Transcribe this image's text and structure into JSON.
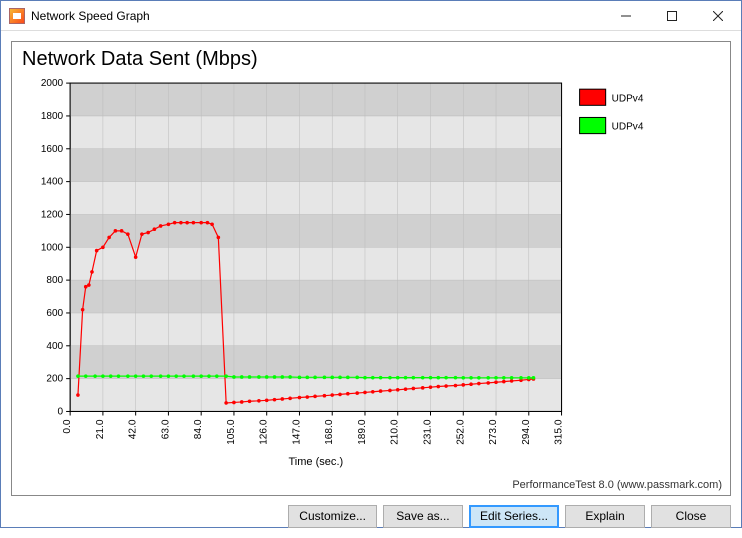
{
  "window": {
    "title": "Network Speed Graph"
  },
  "chart": {
    "title": "Network Data Sent (Mbps)",
    "xlabel": "Time (sec.)",
    "ylim": [
      0,
      2000
    ],
    "yticks": [
      0,
      200,
      400,
      600,
      800,
      1000,
      1200,
      1400,
      1600,
      1800,
      2000
    ],
    "xticks": [
      0.0,
      21.0,
      42.0,
      63.0,
      84.0,
      105.0,
      126.0,
      147.0,
      168.0,
      189.0,
      210.0,
      231.0,
      252.0,
      273.0,
      294.0,
      315.0
    ],
    "legend": [
      {
        "label": "UDPv4",
        "color": "#ff0000"
      },
      {
        "label": "UDPv4",
        "color": "#00ff00"
      }
    ],
    "footer": "PerformanceTest 8.0 (www.passmark.com)"
  },
  "buttons": {
    "customize": "Customize...",
    "saveas": "Save as...",
    "editseries": "Edit Series...",
    "explain": "Explain",
    "close": "Close"
  },
  "chart_data": {
    "type": "line",
    "title": "Network Data Sent (Mbps)",
    "xlabel": "Time (sec.)",
    "ylabel": "",
    "xlim": [
      0,
      315
    ],
    "ylim": [
      0,
      2000
    ],
    "series": [
      {
        "name": "UDPv4",
        "color": "#ff0000",
        "x": [
          5,
          8,
          10,
          12,
          14,
          17,
          21,
          25,
          29,
          33,
          37,
          42,
          46,
          50,
          54,
          58,
          63,
          67,
          71,
          75,
          79,
          84,
          88,
          91,
          95,
          100,
          105,
          110,
          115,
          121,
          126,
          131,
          136,
          141,
          147,
          152,
          157,
          163,
          168,
          173,
          178,
          184,
          189,
          194,
          199,
          205,
          210,
          215,
          220,
          226,
          231,
          236,
          241,
          247,
          252,
          257,
          262,
          268,
          273,
          278,
          283,
          289,
          294,
          297
        ],
        "y": [
          100,
          620,
          760,
          770,
          850,
          980,
          1000,
          1060,
          1100,
          1100,
          1080,
          940,
          1080,
          1090,
          1110,
          1130,
          1140,
          1150,
          1150,
          1150,
          1150,
          1150,
          1150,
          1140,
          1060,
          52,
          55,
          58,
          62,
          65,
          68,
          72,
          76,
          80,
          85,
          88,
          92,
          96,
          100,
          104,
          108,
          112,
          116,
          120,
          124,
          128,
          132,
          136,
          140,
          144,
          148,
          152,
          155,
          158,
          162,
          166,
          170,
          174,
          178,
          182,
          186,
          190,
          195,
          198
        ]
      },
      {
        "name": "UDPv4",
        "color": "#00ff00",
        "x": [
          5,
          10,
          16,
          21,
          26,
          31,
          37,
          42,
          47,
          52,
          58,
          63,
          68,
          73,
          79,
          84,
          89,
          94,
          100,
          105,
          110,
          115,
          121,
          126,
          131,
          136,
          141,
          147,
          152,
          157,
          163,
          168,
          173,
          178,
          184,
          189,
          194,
          199,
          205,
          210,
          215,
          220,
          226,
          231,
          236,
          241,
          247,
          252,
          257,
          262,
          268,
          273,
          278,
          283,
          289,
          294,
          297
        ],
        "y": [
          215,
          215,
          215,
          215,
          215,
          215,
          215,
          215,
          215,
          215,
          215,
          215,
          215,
          215,
          215,
          215,
          215,
          215,
          215,
          210,
          210,
          210,
          210,
          210,
          210,
          210,
          210,
          208,
          208,
          208,
          208,
          208,
          208,
          208,
          208,
          206,
          206,
          206,
          206,
          206,
          206,
          206,
          206,
          206,
          206,
          206,
          206,
          205,
          205,
          205,
          205,
          205,
          205,
          205,
          205,
          205,
          205
        ]
      }
    ]
  }
}
